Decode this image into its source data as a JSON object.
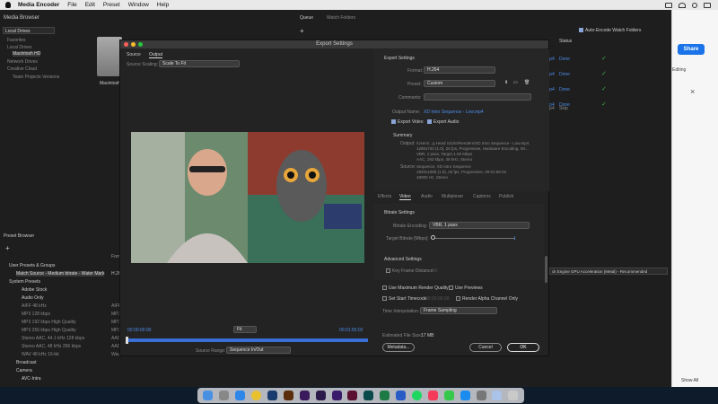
{
  "menubar": {
    "app_name": "Media Encoder",
    "items": [
      "File",
      "Edit",
      "Preset",
      "Window",
      "Help"
    ]
  },
  "media_browser": {
    "title": "Media Browser",
    "location": "Local Drives",
    "tree": [
      "Favorites",
      "Local Drives",
      "Macintosh HD",
      "Network Drives",
      "Creative Cloud",
      "Team Projects Versions"
    ],
    "drive_label": "Macintosh HD"
  },
  "queue": {
    "tabs": [
      "Queue",
      "Watch Folders"
    ],
    "status_header": "Status",
    "auto_encode_label": "Auto-Encode Watch Folders",
    "rows": [
      {
        "format": "mp4",
        "status": "Done"
      },
      {
        "format": "mp4",
        "status": "Done"
      },
      {
        "format": "mp4",
        "status": "Done"
      },
      {
        "format": "mp4",
        "status": "Done"
      },
      {
        "format": "mp4",
        "status": "Skip"
      }
    ],
    "renderer": "ck Engine GPU Acceleration (Metal) - Recommended"
  },
  "preset_browser": {
    "title": "Preset Browser",
    "col_format": "Form",
    "items": [
      {
        "label": "User Presets & Groups",
        "fmt": ""
      },
      {
        "label": "Match Source - Medium bitrate - Water Mark",
        "fmt": "H.26"
      },
      {
        "label": "System Presets",
        "fmt": ""
      },
      {
        "label": "Adobe Stock",
        "fmt": ""
      },
      {
        "label": "Audio Only",
        "fmt": ""
      },
      {
        "label": "AIFF 48 kHz",
        "fmt": "AIFF"
      },
      {
        "label": "MP3 128 kbps",
        "fmt": "MP3"
      },
      {
        "label": "MP3 192 kbps High Quality",
        "fmt": "MP3"
      },
      {
        "label": "MP3 256 kbps High Quality",
        "fmt": "MP3"
      },
      {
        "label": "Stereo AAC, 44.1 kHz 128 kbps",
        "fmt": "AAC"
      },
      {
        "label": "Stereo AAC, 48 kHz 256 kbps",
        "fmt": "AAC"
      },
      {
        "label": "WAV 48 kHz 16-bit",
        "fmt": "Wave"
      },
      {
        "label": "Broadcast",
        "fmt": ""
      },
      {
        "label": "Camera",
        "fmt": ""
      },
      {
        "label": "AVC-Intra",
        "fmt": ""
      }
    ]
  },
  "dialog": {
    "title": "Export Settings",
    "tabs": [
      "Source",
      "Output"
    ],
    "source_scaling_label": "Source Scaling:",
    "source_scaling_value": "Scale To Fit",
    "timecode_start": "00:00:00:00",
    "timecode_end": "00:01:55:02",
    "fit_value": "Fit",
    "source_range_label": "Source Range:",
    "source_range_value": "Sequence In/Out",
    "export_settings_header": "Export Settings",
    "format_label": "Format:",
    "format_value": "H.264",
    "preset_label": "Preset:",
    "preset_value": "Custom",
    "comments_label": "Comments:",
    "output_name_label": "Output Name:",
    "output_name_value": "XD Intro Sequence - Low.mp4",
    "export_video_label": "Export Video",
    "export_audio_label": "Export Audio",
    "summary_header": "Summary",
    "summary_output_label": "Output:",
    "summary_output_lines": [
      "/Users/...g Head Sizzle/Renders/XD Intro Sequence - Low.mp4",
      "1280x720 (1.0), 25 fps, Progressive, Hardware Encoding, 00...",
      "VBR, 1 pass, Target 1.00 Mbps",
      "AAC, 192 kbps, 48 kHz, Stereo"
    ],
    "summary_source_label": "Source:",
    "summary_source_lines": [
      "Sequence, XD Intro Sequence",
      "1920x1080 (1.0), 25 fps, Progressive, 00:01:55:02",
      "48000 Hz, Stereo"
    ],
    "settings_tabs": [
      "Effects",
      "Video",
      "Audio",
      "Multiplexer",
      "Captions",
      "Publish"
    ],
    "bitrate_header": "Bitrate Settings",
    "bitrate_encoding_label": "Bitrate Encoding:",
    "bitrate_encoding_value": "VBR, 1 pass",
    "target_bitrate_label": "Target Bitrate [Mbps]:",
    "target_bitrate_value": "1",
    "advanced_header": "Advanced Settings",
    "key_frame_label": "Key Frame Distance:",
    "key_frame_value": "60",
    "use_max_render_label": "Use Maximum Render Quality",
    "use_previews_label": "Use Previews",
    "set_start_tc_label": "Set Start Timecode",
    "set_start_tc_value": "00;00;00;00",
    "render_alpha_label": "Render Alpha Channel Only",
    "time_interp_label": "Time Interpolation:",
    "time_interp_value": "Frame Sampling",
    "est_size_label": "Estimated File Size:",
    "est_size_value": "17 MB",
    "metadata_btn": "Metadata...",
    "cancel_btn": "Cancel",
    "ok_btn": "OK"
  },
  "browser": {
    "share_label": "Share",
    "editing_label": "Editing",
    "show_all_label": "Show All"
  },
  "colors": {
    "accent_blue": "#4d8ce8",
    "done_green": "#3cb04a",
    "share_blue": "#1a73e8"
  }
}
